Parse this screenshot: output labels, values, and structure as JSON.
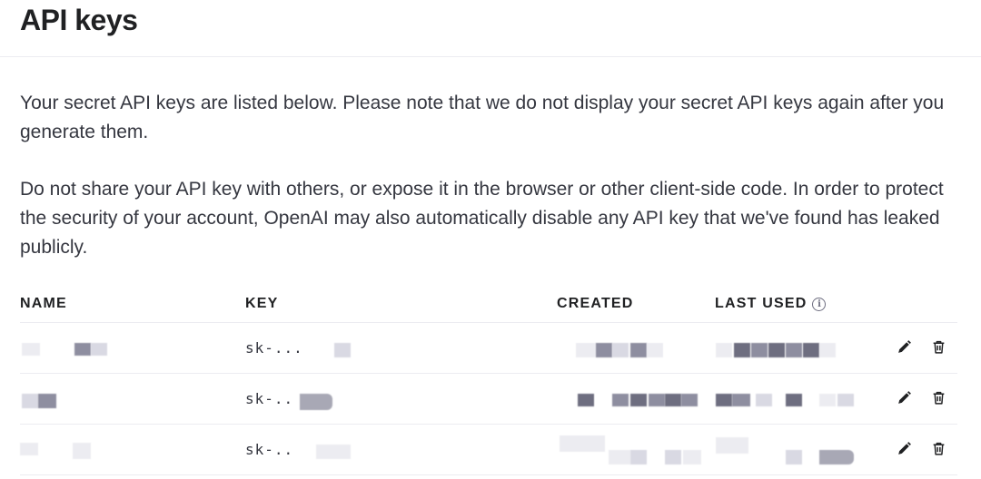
{
  "page": {
    "title": "API keys",
    "description_1": "Your secret API keys are listed below. Please note that we do not display your secret API keys again after you generate them.",
    "description_2": "Do not share your API key with others, or expose it in the browser or other client-side code. In order to protect the security of your account, OpenAI may also automatically disable any API key that we've found has leaked publicly."
  },
  "table": {
    "columns": [
      "NAME",
      "KEY",
      "CREATED",
      "LAST USED"
    ],
    "rows": [
      {
        "key": "sk-...",
        "actions": [
          "pencil-icon",
          "trash-icon"
        ]
      },
      {
        "key": "sk-..",
        "actions": [
          "pencil-icon",
          "trash-icon"
        ]
      },
      {
        "key": "sk-..",
        "actions": [
          "pencil-icon",
          "trash-icon"
        ]
      }
    ]
  }
}
